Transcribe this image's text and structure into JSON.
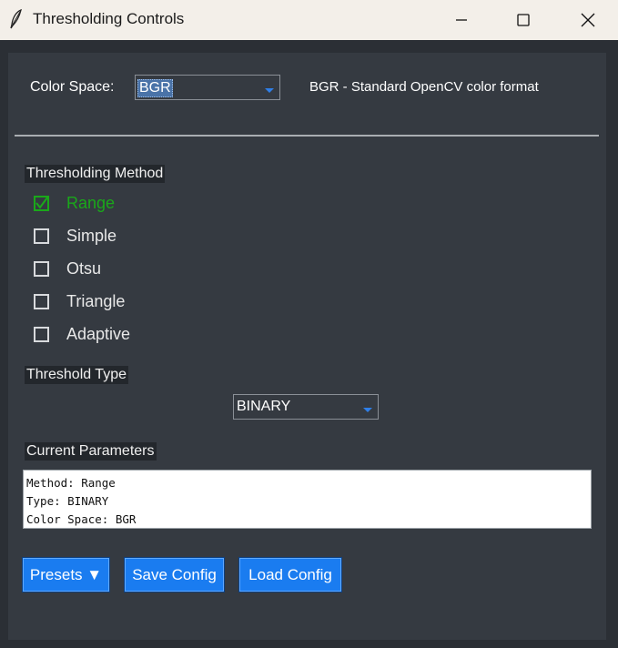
{
  "window": {
    "title": "Thresholding Controls"
  },
  "color_space": {
    "label": "Color Space:",
    "value": "BGR",
    "description": "BGR - Standard OpenCV color format"
  },
  "method": {
    "section_label": "Thresholding Method",
    "options": [
      {
        "label": "Range",
        "checked": true
      },
      {
        "label": "Simple",
        "checked": false
      },
      {
        "label": "Otsu",
        "checked": false
      },
      {
        "label": "Triangle",
        "checked": false
      },
      {
        "label": "Adaptive",
        "checked": false
      }
    ]
  },
  "threshold_type": {
    "section_label": "Threshold Type",
    "value": "BINARY"
  },
  "parameters": {
    "section_label": "Current Parameters",
    "lines": [
      "Method: Range",
      "Type: BINARY",
      "Color Space: BGR"
    ]
  },
  "buttons": {
    "presets": "Presets ▼",
    "save": "Save Config",
    "load": "Load Config"
  },
  "colors": {
    "accent": "#1a7cf0",
    "checked_green": "#1aa81a",
    "panel_bg": "#353a41",
    "titlebar_bg": "#f3efe9"
  }
}
